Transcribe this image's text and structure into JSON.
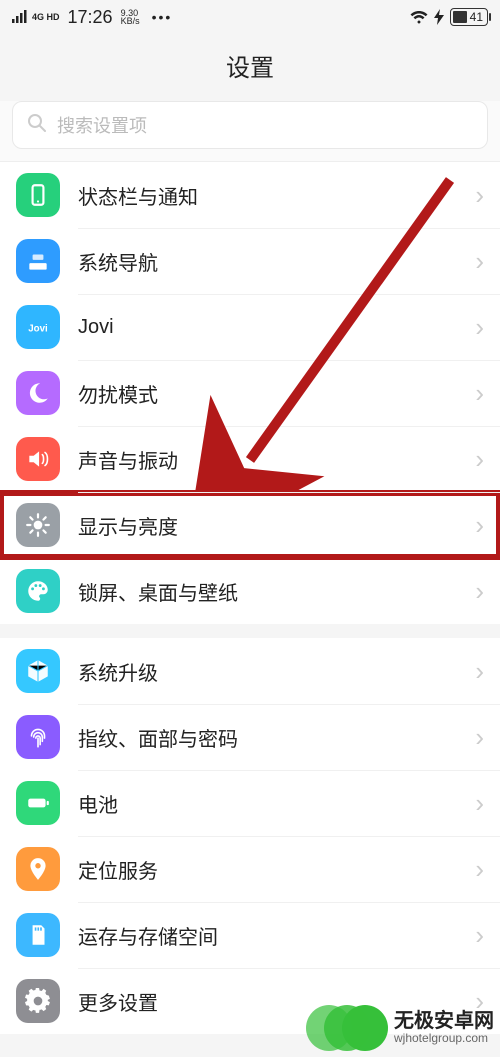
{
  "status": {
    "network": "4G HD",
    "time": "17:26",
    "speed_top": "9.30",
    "speed_bottom": "KB/s",
    "battery": "41"
  },
  "title": "设置",
  "search": {
    "placeholder": "搜索设置项"
  },
  "groups": [
    {
      "items": [
        {
          "id": "statusbar",
          "label": "状态栏与通知",
          "icon": "notify",
          "color": "#26d07c"
        },
        {
          "id": "nav",
          "label": "系统导航",
          "icon": "nav",
          "color": "#2e9cff"
        },
        {
          "id": "jovi",
          "label": "Jovi",
          "icon": "jovi",
          "color": "#2fb6ff"
        },
        {
          "id": "dnd",
          "label": "勿扰模式",
          "icon": "moon",
          "color": "#b56bff"
        },
        {
          "id": "sound",
          "label": "声音与振动",
          "icon": "sound",
          "color": "#ff5a4d"
        },
        {
          "id": "display",
          "label": "显示与亮度",
          "icon": "bright",
          "color": "#9aa0a6",
          "highlight": true
        },
        {
          "id": "lock",
          "label": "锁屏、桌面与壁纸",
          "icon": "palette",
          "color": "#2fd0c6"
        }
      ]
    },
    {
      "items": [
        {
          "id": "upgrade",
          "label": "系统升级",
          "icon": "cube",
          "color": "#35c8ff"
        },
        {
          "id": "biometric",
          "label": "指纹、面部与密码",
          "icon": "finger",
          "color": "#8a5cff"
        },
        {
          "id": "battery",
          "label": "电池",
          "icon": "battery",
          "color": "#2fd87a"
        },
        {
          "id": "location",
          "label": "定位服务",
          "icon": "pin",
          "color": "#ff9b3d"
        },
        {
          "id": "storage",
          "label": "运存与存储空间",
          "icon": "sd",
          "color": "#3db8ff"
        },
        {
          "id": "more",
          "label": "更多设置",
          "icon": "gear",
          "color": "#8e8e93"
        }
      ]
    }
  ],
  "watermark": {
    "title": "无极安卓网",
    "sub": "wjhotelgroup.com"
  }
}
